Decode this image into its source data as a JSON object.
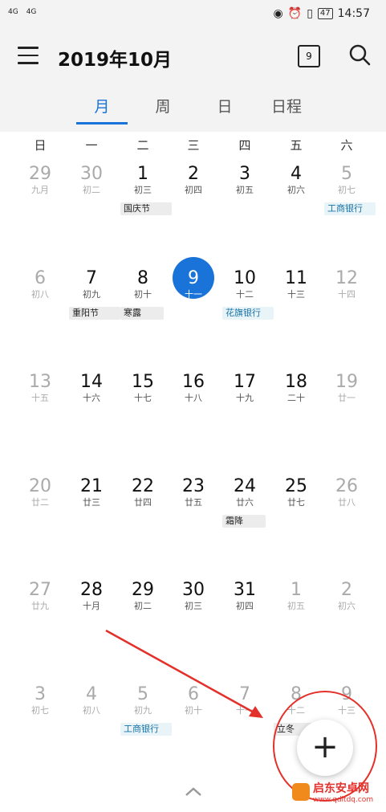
{
  "status": {
    "signal1": "4G",
    "signal2": "4G",
    "battery": "47",
    "time": "14:57"
  },
  "header": {
    "title": "2019年10月",
    "calendar_icon_day": "9"
  },
  "tabs": [
    "月",
    "周",
    "日",
    "日程"
  ],
  "weekdays": [
    "日",
    "一",
    "二",
    "三",
    "四",
    "五",
    "六"
  ],
  "days": [
    {
      "n": "29",
      "l": "九月",
      "m": true
    },
    {
      "n": "30",
      "l": "初二",
      "m": true
    },
    {
      "n": "1",
      "l": "初三",
      "e": "国庆节"
    },
    {
      "n": "2",
      "l": "初四"
    },
    {
      "n": "3",
      "l": "初五"
    },
    {
      "n": "4",
      "l": "初六"
    },
    {
      "n": "5",
      "l": "初七",
      "m": true,
      "e": "工商银行",
      "eb": true
    },
    {
      "n": "6",
      "l": "初八",
      "m": true
    },
    {
      "n": "7",
      "l": "初九",
      "e": "重阳节"
    },
    {
      "n": "8",
      "l": "初十",
      "e": "寒露"
    },
    {
      "n": "9",
      "l": "十一",
      "t": true
    },
    {
      "n": "10",
      "l": "十二",
      "e": "花旗银行",
      "eb": true
    },
    {
      "n": "11",
      "l": "十三"
    },
    {
      "n": "12",
      "l": "十四",
      "m": true
    },
    {
      "n": "13",
      "l": "十五",
      "m": true
    },
    {
      "n": "14",
      "l": "十六"
    },
    {
      "n": "15",
      "l": "十七"
    },
    {
      "n": "16",
      "l": "十八"
    },
    {
      "n": "17",
      "l": "十九"
    },
    {
      "n": "18",
      "l": "二十"
    },
    {
      "n": "19",
      "l": "廿一",
      "m": true
    },
    {
      "n": "20",
      "l": "廿二",
      "m": true
    },
    {
      "n": "21",
      "l": "廿三"
    },
    {
      "n": "22",
      "l": "廿四"
    },
    {
      "n": "23",
      "l": "廿五"
    },
    {
      "n": "24",
      "l": "廿六",
      "e": "霜降"
    },
    {
      "n": "25",
      "l": "廿七"
    },
    {
      "n": "26",
      "l": "廿八",
      "m": true
    },
    {
      "n": "27",
      "l": "廿九",
      "m": true
    },
    {
      "n": "28",
      "l": "十月"
    },
    {
      "n": "29",
      "l": "初二"
    },
    {
      "n": "30",
      "l": "初三"
    },
    {
      "n": "31",
      "l": "初四"
    },
    {
      "n": "1",
      "l": "初五",
      "m": true
    },
    {
      "n": "2",
      "l": "初六",
      "m": true
    },
    {
      "n": "3",
      "l": "初七",
      "m": true
    },
    {
      "n": "4",
      "l": "初八",
      "m": true
    },
    {
      "n": "5",
      "l": "初九",
      "m": true,
      "e": "工商银行",
      "eb": true
    },
    {
      "n": "6",
      "l": "初十",
      "m": true
    },
    {
      "n": "7",
      "l": "十一",
      "m": true
    },
    {
      "n": "8",
      "l": "十二",
      "m": true,
      "e": "立冬"
    },
    {
      "n": "9",
      "l": "十三",
      "m": true
    }
  ],
  "fab": {
    "label": "+"
  },
  "watermark": {
    "name": "启东安卓网",
    "url": "www.qdltdq.com"
  }
}
